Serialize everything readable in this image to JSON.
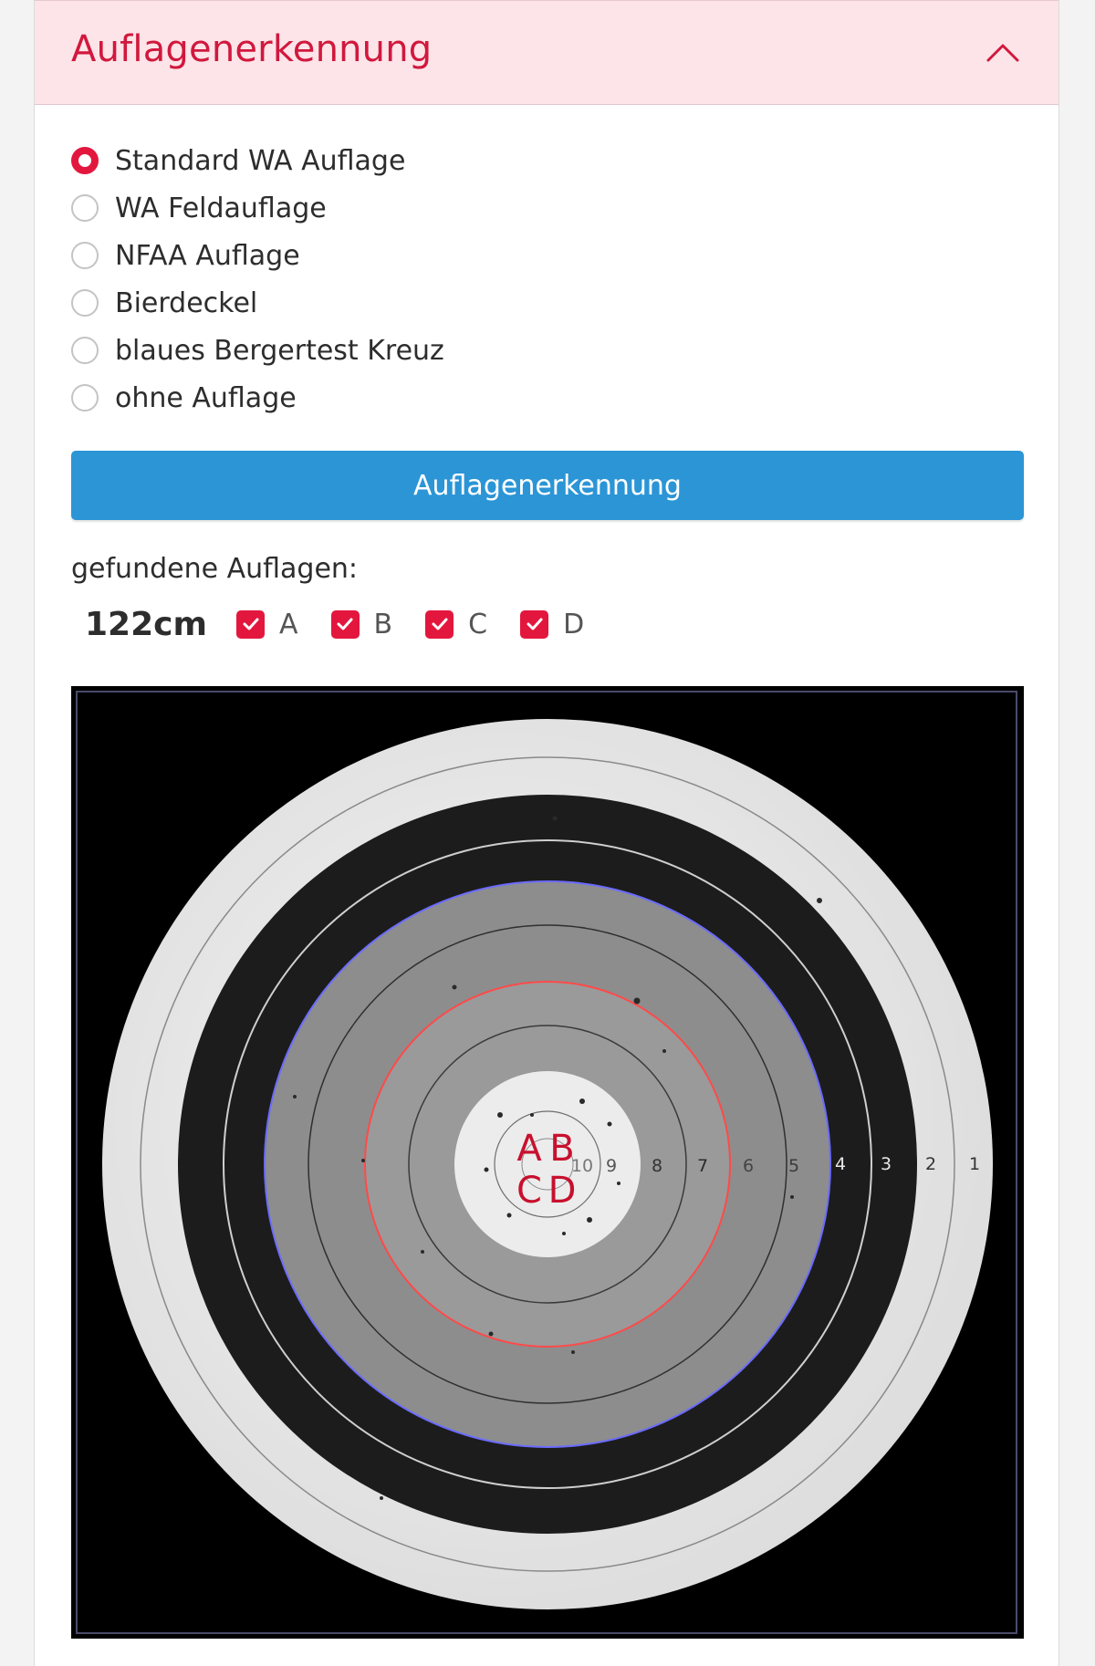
{
  "panel": {
    "title": "Auflagenerkennung"
  },
  "options": [
    {
      "label": "Standard WA Auflage",
      "checked": true
    },
    {
      "label": "WA Feldauflage",
      "checked": false
    },
    {
      "label": "NFAA Auflage",
      "checked": false
    },
    {
      "label": "Bierdeckel",
      "checked": false
    },
    {
      "label": "blaues Bergertest Kreuz",
      "checked": false
    },
    {
      "label": "ohne Auflage",
      "checked": false
    }
  ],
  "detect_button": {
    "label": "Auflagenerkennung"
  },
  "found": {
    "label": "gefundene Auflagen:",
    "size": "122cm",
    "targets": [
      {
        "label": "A",
        "checked": true
      },
      {
        "label": "B",
        "checked": true
      },
      {
        "label": "C",
        "checked": true
      },
      {
        "label": "D",
        "checked": true
      }
    ]
  },
  "target_image": {
    "ring_numbers": [
      "10",
      "9",
      "8",
      "7",
      "6",
      "5",
      "4",
      "3",
      "2",
      "1"
    ],
    "marker_labels": [
      "A",
      "B",
      "C",
      "D"
    ]
  },
  "colors": {
    "accent": "#e3173e",
    "header_bg": "#fce4e8",
    "button": "#2b95d6",
    "outline_blue": "#6b6bff",
    "outline_red": "#ff4a4a"
  }
}
